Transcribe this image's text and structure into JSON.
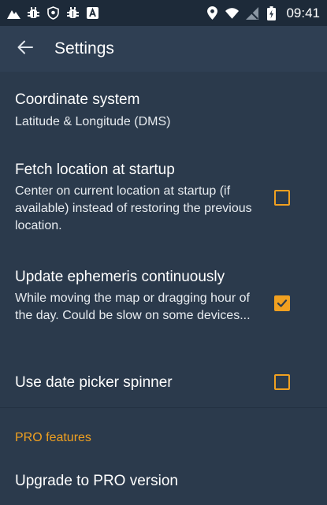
{
  "status_bar": {
    "time": "09:41",
    "left_icons": [
      "mountain-icon",
      "bug-icon",
      "shield-icon",
      "bug-icon",
      "a-box-icon"
    ],
    "right_icons": [
      "location-pin-icon",
      "wifi-icon",
      "no-signal-icon",
      "battery-charging-icon"
    ]
  },
  "app_bar": {
    "title": "Settings",
    "back_icon": "arrow-left-icon"
  },
  "preferences": {
    "coordinate_system": {
      "title": "Coordinate system",
      "summary": "Latitude & Longitude (DMS)"
    },
    "fetch_location": {
      "title": "Fetch location at startup",
      "summary": "Center on current location at startup (if available) instead of restoring the previous location.",
      "checked": false
    },
    "update_ephemeris": {
      "title": "Update ephemeris continuously",
      "summary": "While moving the map or dragging hour of the day. Could be slow on some devices...",
      "checked": true
    },
    "date_picker_spinner": {
      "title": "Use date picker spinner",
      "checked": false
    }
  },
  "pro_section": {
    "header": "PRO features",
    "upgrade_title": "Upgrade to PRO version"
  },
  "colors": {
    "background": "#2b3a4c",
    "status_bar": "#1d2a39",
    "app_bar": "#2f3f53",
    "accent": "#f0a020"
  }
}
